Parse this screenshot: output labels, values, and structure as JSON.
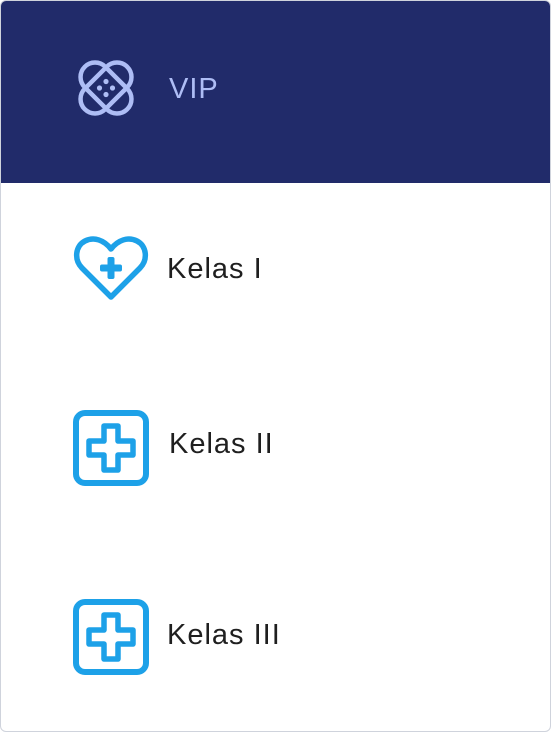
{
  "menu": {
    "items": [
      {
        "label": "VIP",
        "icon": "bandage-icon",
        "active": true
      },
      {
        "label": "Kelas I",
        "icon": "heart-plus-icon",
        "active": false
      },
      {
        "label": "Kelas II",
        "icon": "medical-cross-icon",
        "active": false
      },
      {
        "label": "Kelas III",
        "icon": "medical-cross-icon",
        "active": false
      }
    ]
  },
  "colors": {
    "active_background": "#212B6A",
    "active_text": "#AEBDF5",
    "icon_blue": "#1DA1E8",
    "text": "#1F1F1F",
    "border": "#CFD3DC"
  }
}
